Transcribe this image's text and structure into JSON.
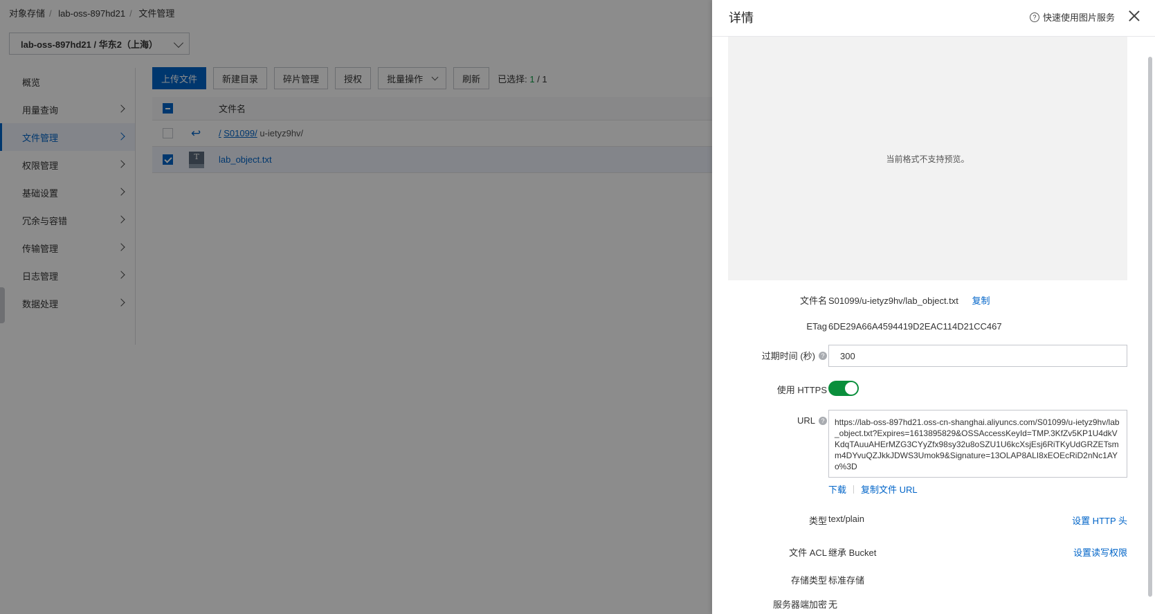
{
  "breadcrumb": [
    "对象存储",
    "lab-oss-897hd21",
    "文件管理"
  ],
  "bucket_select": "lab-oss-897hd21 / 华东2（上海）",
  "sidebar": {
    "items": [
      {
        "label": "概览"
      },
      {
        "label": "用量查询"
      },
      {
        "label": "文件管理"
      },
      {
        "label": "权限管理"
      },
      {
        "label": "基础设置"
      },
      {
        "label": "冗余与容错"
      },
      {
        "label": "传输管理"
      },
      {
        "label": "日志管理"
      },
      {
        "label": "数据处理"
      }
    ]
  },
  "toolbar": {
    "upload": "上传文件",
    "new_dir": "新建目录",
    "fragments": "碎片管理",
    "authorize": "授权",
    "batch": "批量操作",
    "refresh": "刷新",
    "selected_label": "已选择:",
    "selected_count": "1",
    "selected_sep": " / ",
    "selected_total": "1"
  },
  "table": {
    "header_name": "文件名",
    "path_root": "/",
    "path_dir": "S01099/",
    "path_current": "u-ietyz9hv/",
    "file_icon_letter": "T",
    "file_name": "lab_object.txt"
  },
  "drawer": {
    "title": "详情",
    "help": "快速使用图片服务",
    "preview_text": "当前格式不支持预览。",
    "filename_label": "文件名",
    "filename_value": "S01099/u-ietyz9hv/lab_object.txt",
    "copy": "复制",
    "etag_label": "ETag",
    "etag_value": "6DE29A66A4594419D2EAC114D21CC467",
    "expire_label": "过期时间 (秒)",
    "expire_value": "300",
    "https_label": "使用 HTTPS",
    "url_label": "URL",
    "url_value": "https://lab-oss-897hd21.oss-cn-shanghai.aliyuncs.com/S01099/u-ietyz9hv/lab_object.txt?Expires=1613895829&OSSAccessKeyId=TMP.3KfZv5KP1U4dkVKdqTAuuAHErMZG3CYyZfx98sy32u8oSZU1U6kcXsjEsj6RiTKyUdGRZETsmm4DYvuQZJkkJDWS3Umok9&Signature=13OLAP8ALI8xEOEcRiD2nNc1AYo%3D",
    "download": "下载",
    "copy_url": "复制文件 URL",
    "type_label": "类型",
    "type_value": "text/plain",
    "set_http_header": "设置 HTTP 头",
    "acl_label": "文件 ACL",
    "acl_value": "继承 Bucket",
    "set_acl": "设置读写权限",
    "storage_label": "存储类型",
    "storage_value": "标准存储",
    "encrypt_label": "服务器端加密",
    "encrypt_value": "无"
  }
}
